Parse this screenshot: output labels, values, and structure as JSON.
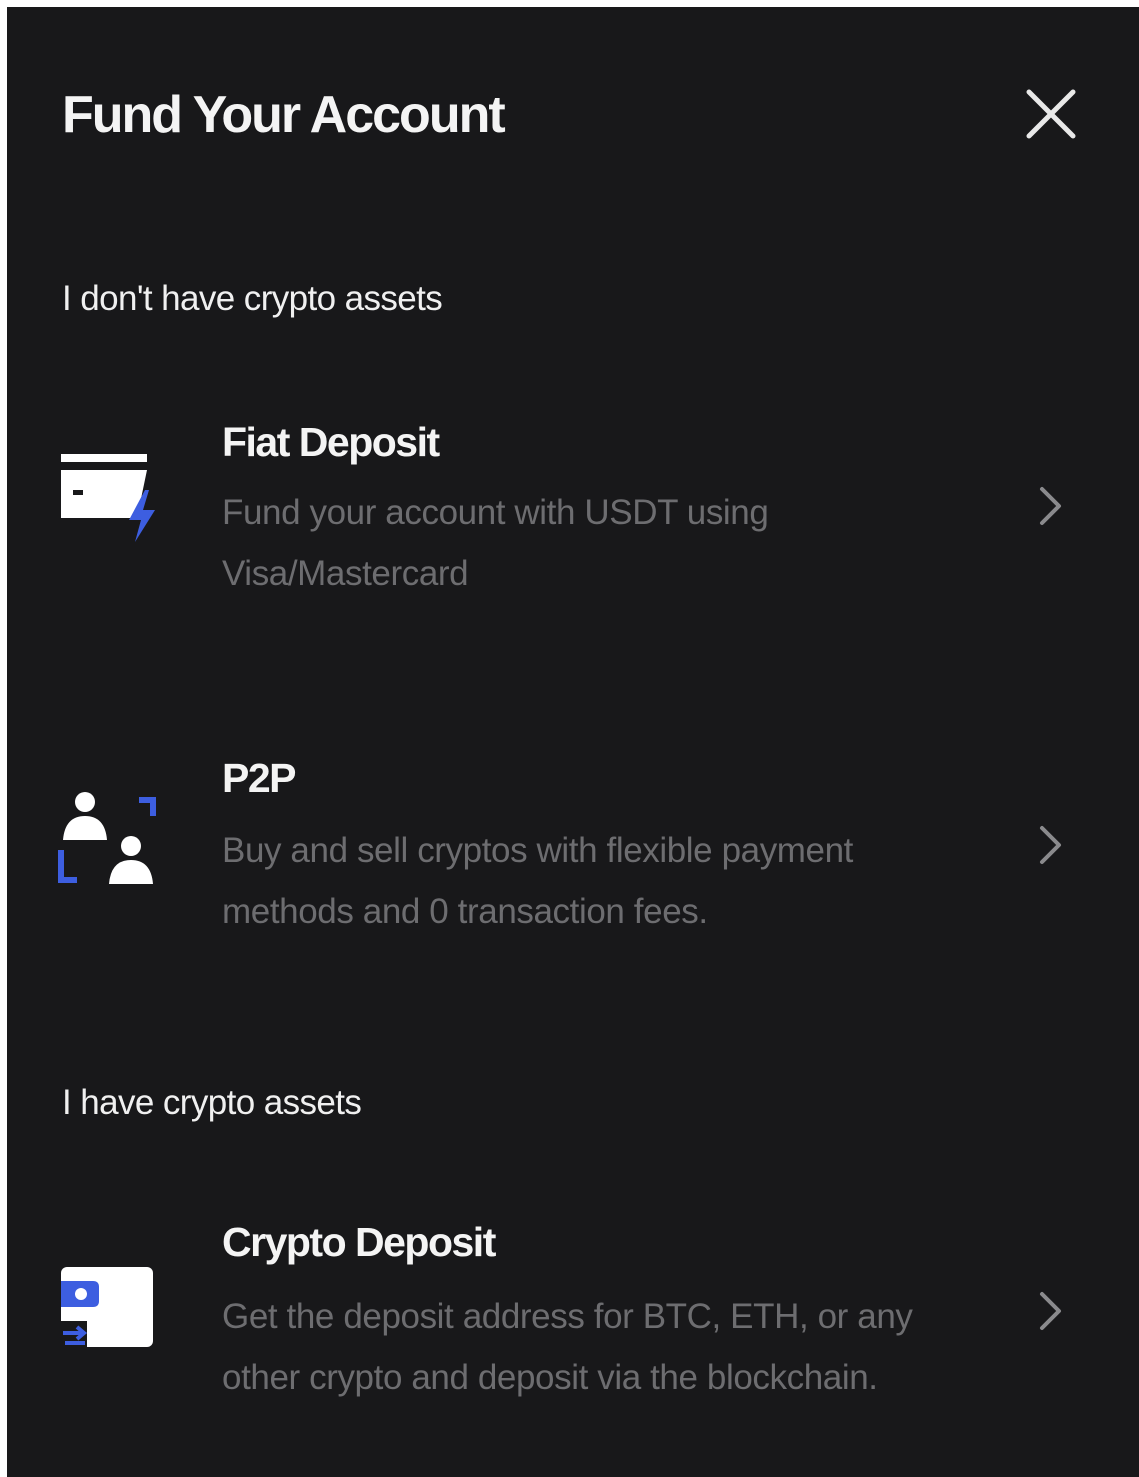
{
  "modal": {
    "title": "Fund Your Account",
    "close_icon": "close-icon"
  },
  "sections": [
    {
      "label": "I don't have crypto assets",
      "options": [
        {
          "title": "Fiat Deposit",
          "description": "Fund your account with USDT using Visa/Mastercard",
          "icon": "card-lightning-icon"
        },
        {
          "title": "P2P",
          "description": "Buy and sell cryptos with flexible payment methods and 0 transaction fees.",
          "icon": "p2p-users-icon"
        }
      ]
    },
    {
      "label": "I have crypto assets",
      "options": [
        {
          "title": "Crypto Deposit",
          "description": "Get the deposit address for BTC, ETH, or any other crypto and deposit via the blockchain.",
          "icon": "wallet-deposit-icon"
        }
      ]
    }
  ],
  "colors": {
    "background": "#18181a",
    "title_text": "#f4f4f4",
    "description_text": "#6d6d70",
    "accent_blue": "#3d5ee0"
  }
}
